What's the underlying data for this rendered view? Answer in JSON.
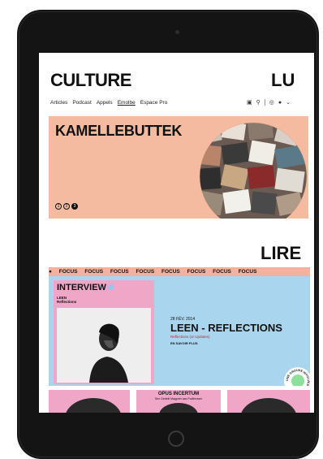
{
  "header": {
    "logo_left": "CULTURE",
    "logo_right": "LU"
  },
  "nav": {
    "items": [
      {
        "label": "Articles",
        "active": false
      },
      {
        "label": "Podcast",
        "active": false
      },
      {
        "label": "Appels",
        "active": false
      },
      {
        "label": "Emolbe",
        "active": true
      },
      {
        "label": "Espace Pro",
        "active": false
      }
    ]
  },
  "hero": {
    "title": "KAMELLEBUTTEK",
    "slides": [
      "1",
      "2",
      "3"
    ],
    "active_slide": 3
  },
  "section": {
    "title": "LIRE",
    "ticker_label": "FOCUS"
  },
  "interview": {
    "label": "INTERVIEW",
    "name": "LEEN",
    "sub": "Reflections",
    "date": "28 FÉV. 2014",
    "title": "LEEN - REFLECTIONS",
    "subtitle": "Reflections (or Updates)",
    "meta": "EN SAVOIR PLUS"
  },
  "bottom_cards": [
    {
      "title": "",
      "sub": ""
    },
    {
      "title": "OPUS INCERTUM",
      "sub": "Sen Gedelti Magprier ass Podthrower"
    },
    {
      "title": "",
      "sub": ""
    }
  ],
  "badge": {
    "text": "UNE GROUPE INVOLVED"
  },
  "colors": {
    "hero_bg": "#f4bba0",
    "focus_bg": "#a9d6ee",
    "pink": "#f0a6c6",
    "badge": "#8de09a"
  }
}
